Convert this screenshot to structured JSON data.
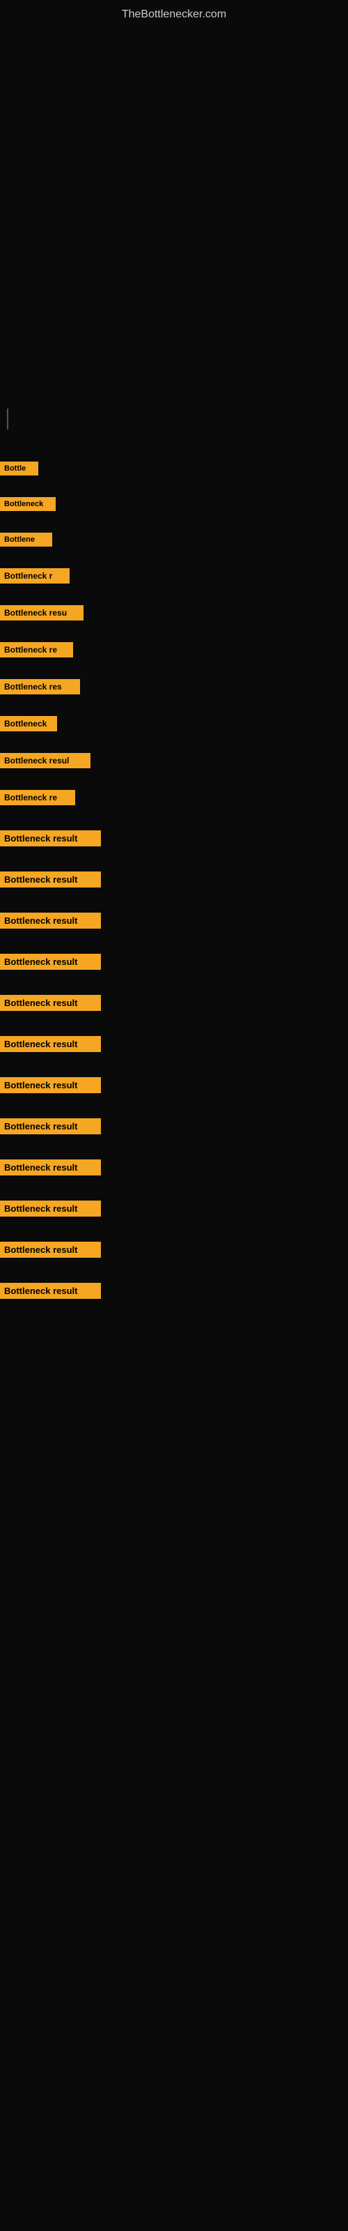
{
  "site": {
    "title": "TheBottlenecker.com"
  },
  "results": [
    {
      "id": 1,
      "label": "Bottle",
      "width": 55
    },
    {
      "id": 2,
      "label": "Bottleneck",
      "width": 80
    },
    {
      "id": 3,
      "label": "Bottlene",
      "width": 75
    },
    {
      "id": 4,
      "label": "Bottleneck r",
      "width": 100
    },
    {
      "id": 5,
      "label": "Bottleneck resu",
      "width": 120
    },
    {
      "id": 6,
      "label": "Bottleneck re",
      "width": 108
    },
    {
      "id": 7,
      "label": "Bottleneck res",
      "width": 112
    },
    {
      "id": 8,
      "label": "Bottleneck",
      "width": 82
    },
    {
      "id": 9,
      "label": "Bottleneck resul",
      "width": 128
    },
    {
      "id": 10,
      "label": "Bottleneck re",
      "width": 106
    },
    {
      "id": 11,
      "label": "Bottleneck result",
      "width": 140
    },
    {
      "id": 12,
      "label": "Bottleneck result",
      "width": 140
    },
    {
      "id": 13,
      "label": "Bottleneck result",
      "width": 140
    },
    {
      "id": 14,
      "label": "Bottleneck result",
      "width": 140
    },
    {
      "id": 15,
      "label": "Bottleneck result",
      "width": 140
    },
    {
      "id": 16,
      "label": "Bottleneck result",
      "width": 140
    },
    {
      "id": 17,
      "label": "Bottleneck result",
      "width": 140
    },
    {
      "id": 18,
      "label": "Bottleneck result",
      "width": 140
    },
    {
      "id": 19,
      "label": "Bottleneck result",
      "width": 140
    },
    {
      "id": 20,
      "label": "Bottleneck result",
      "width": 140
    },
    {
      "id": 21,
      "label": "Bottleneck result",
      "width": 140
    },
    {
      "id": 22,
      "label": "Bottleneck result",
      "width": 140
    }
  ],
  "colors": {
    "background": "#0a0a0a",
    "accent": "#f5a623",
    "text": "#cccccc"
  }
}
